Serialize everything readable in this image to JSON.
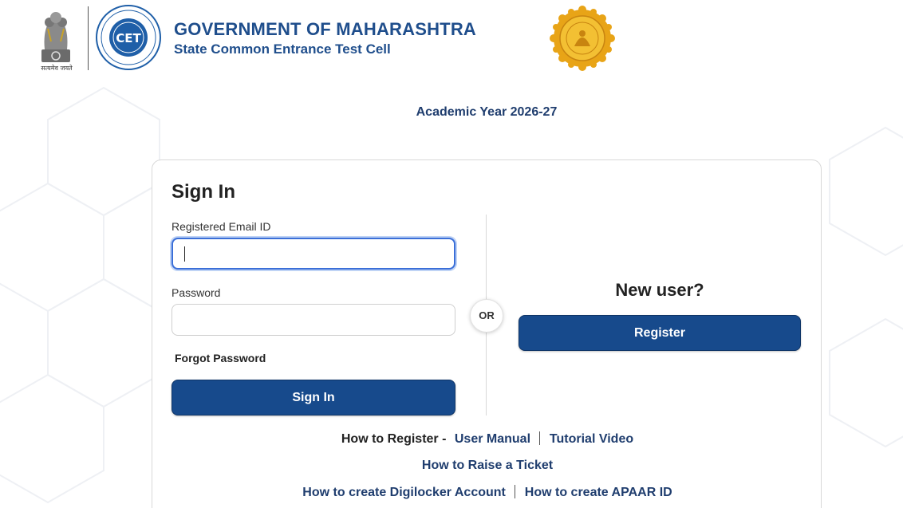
{
  "header": {
    "emblem_caption": "सत्यमेव जयते",
    "logo_text": "CET",
    "org_title": "GOVERNMENT OF MAHARASHTRA",
    "org_subtitle": "State Common Entrance Test Cell"
  },
  "academic_year": "Academic Year 2026-27",
  "signin": {
    "title": "Sign In",
    "email_label": "Registered Email ID",
    "email_value": "",
    "password_label": "Password",
    "password_value": "",
    "forgot_label": "Forgot Password",
    "button_label": "Sign In"
  },
  "or_label": "OR",
  "newuser": {
    "title": "New user?",
    "button_label": "Register"
  },
  "help_links": {
    "register_prefix": "How to Register -",
    "user_manual": "User Manual",
    "tutorial_video": "Tutorial Video",
    "raise_ticket": "How to Raise a Ticket",
    "digilocker": "How to create Digilocker Account",
    "apaar": "How to create APAAR ID"
  },
  "colors": {
    "brand_blue": "#1f4e8c",
    "button_blue": "#174a8c",
    "seal_gold": "#e8a417"
  }
}
